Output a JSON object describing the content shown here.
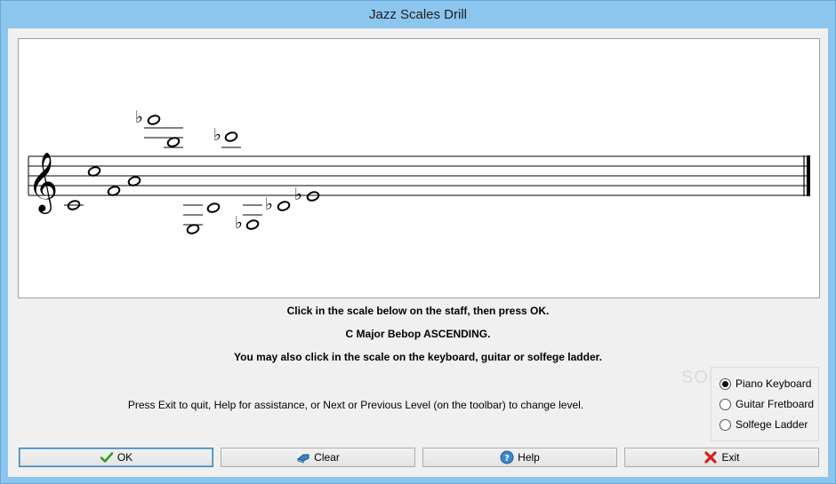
{
  "window": {
    "title": "Jazz Scales Drill"
  },
  "messages": {
    "instruction": "Click in the scale below on the staff, then press OK.",
    "scale_name": "C Major Bebop ASCENDING.",
    "alt_instruction": "You may also click in the scale on the keyboard, guitar or solfege ladder.",
    "help_text": "Press Exit to quit, Help for assistance, or Next or Previous Level (on the toolbar) to change level."
  },
  "input_mode": {
    "options": [
      "Piano Keyboard",
      "Guitar Fretboard",
      "Solfege Ladder"
    ],
    "selected": "Piano Keyboard"
  },
  "watermark": "SOFT",
  "buttons": {
    "ok": {
      "label": "OK",
      "icon": "checkmark-icon"
    },
    "clear": {
      "label": "Clear",
      "icon": "eraser-icon"
    },
    "help": {
      "label": "Help",
      "icon": "help-globe-icon"
    },
    "exit": {
      "label": "Exit",
      "icon": "red-x-icon"
    }
  },
  "staff": {
    "clef": "treble",
    "notes": [
      "C4",
      "G4",
      "E4",
      "F4",
      "Bb5",
      "A5",
      "C3",
      "A3",
      "Bb5",
      "Bb3",
      "Bb3",
      "Bb4"
    ]
  }
}
